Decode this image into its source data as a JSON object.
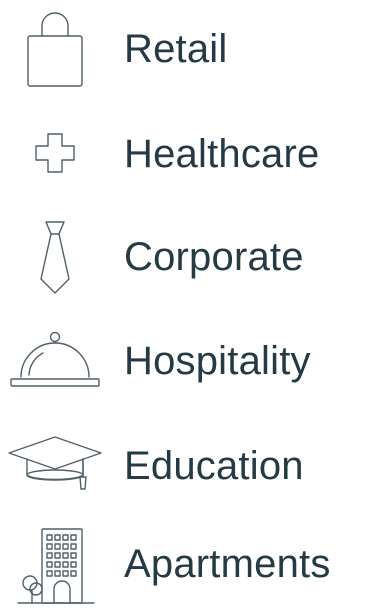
{
  "items": [
    {
      "label": "Retail",
      "icon": "shopping-bag-icon"
    },
    {
      "label": "Healthcare",
      "icon": "medical-cross-icon"
    },
    {
      "label": "Corporate",
      "icon": "necktie-icon"
    },
    {
      "label": "Hospitality",
      "icon": "serving-cloche-icon"
    },
    {
      "label": "Education",
      "icon": "graduation-cap-icon"
    },
    {
      "label": "Apartments",
      "icon": "apartment-building-icon"
    }
  ],
  "colors": {
    "text": "#243a45",
    "icon_stroke": "#4f6068",
    "background": "#ffffff"
  }
}
